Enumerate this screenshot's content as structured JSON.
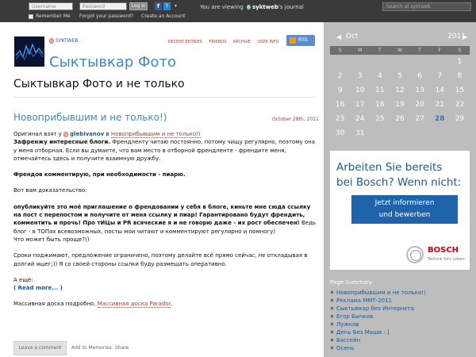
{
  "topbar": {
    "username_placeholder": "Username",
    "password_placeholder": "Password",
    "login_label": "Log in",
    "remember_me": "Remember Me",
    "forgot_password": "Forgot your password?",
    "create_account": "Create an Account",
    "viewing_prefix": "You are viewing",
    "viewing_user": "syktweb",
    "viewing_suffix": "'s journal",
    "search_placeholder": "Search at syktweb"
  },
  "header": {
    "username": "SYKTWEB",
    "journal_title": "Сыктывкар Фото",
    "subtitle": "Сыктывкар Фото и не только",
    "nav": [
      "RECENT ENTRIES",
      "FRIENDS",
      "ARCHIVE",
      "USER INFO"
    ],
    "rss": "RSS"
  },
  "entry": {
    "title": "Новоприбывшим и не только!)",
    "date": "October 28th, 2011",
    "orig_prefix": "Оригинал взят у",
    "orig_user": "glebivanov",
    "orig_in": "в",
    "orig_link": "Новоприбывшим и не только!)",
    "p1_bold": "Зафренжу интересные блоги.",
    "p1_rest": "Френдленту читаю постоянно, потому чищу регулярно, поэтому она у меня отборная. Если вы думаете, что вам место в отборной френдленте - френдите меня, отмечайтесь здесь и получите взаимную дружбу.",
    "p2": "Френдов комментирую, при необходимости - пиарю.",
    "p3": "Вот вам доказательство:",
    "p4_bold": "опубликуйте это моё приглашение о френдовании у себя в блоге, киньте мне сюда ссылку на пост с перепостом и получите от меня ссылку и пиар! Гарантировано будут френдить, комментить и прочь! Про тИЦы и PR всяческие я и не говорю даже - их рост обеспечен!",
    "p4_rest": "Ведь блог - в ТОПах всевозможных, посты мои читают и комментируют регулярно и помногу)",
    "p5": "Что может быть проще?))",
    "p6": "Сроки поджимают, предложение ограничено, поэтому делайте всё прямо сейчас, не откладывая в долгий ящег;)) Я со своей стороны ссылки буду размещать оперативно.",
    "p7": "А ещё:",
    "read_more": "( Read more... )",
    "p8_prefix": "Массивная доска подробно.",
    "p8_link": "Массивная доска Parador",
    "leave_comment": "Leave a comment",
    "add_memories": "Add to Memories",
    "share": "Share"
  },
  "calendar": {
    "month": "Oct",
    "year": "2011",
    "dow": [
      "S",
      "M",
      "T",
      "W",
      "T",
      "F",
      "S"
    ],
    "weeks": [
      [
        "",
        "",
        "",
        "",
        "",
        "",
        "1"
      ],
      [
        "2",
        "3",
        "4",
        "5",
        "6",
        "7",
        "8"
      ],
      [
        "9",
        "10",
        "11",
        "12",
        "13",
        "14",
        "15"
      ],
      [
        "16",
        "17",
        "18",
        "19",
        "20",
        "21",
        "22"
      ],
      [
        "23",
        "24",
        "25",
        "26",
        "27",
        "28",
        "29"
      ],
      [
        "30",
        "31",
        "",
        "",
        "",
        "",
        ""
      ]
    ],
    "today": "28"
  },
  "ad": {
    "line1": "Arbeiten Sie bereits",
    "line2": "bei Bosch? Wenn nicht:",
    "button_line1": "Jetzt informieren",
    "button_line2": "und bewerben",
    "brand": "BOSCH",
    "tagline": "Technik fürs Leben"
  },
  "summary": {
    "title": "Page Summary",
    "items": [
      "Новоприбывшим и не только!)",
      "Реклама ММТ-2011",
      "Сыктывкар без Интернета",
      "Егор Бычков",
      "Лужков",
      "День Без Маши : ]",
      "Бассейн",
      "Осень"
    ]
  },
  "colors": {
    "accent": "#3a8ac8",
    "link_red": "#c0392b",
    "topbar": "#3a3a3a",
    "sidebar": "#bdbdbd"
  }
}
